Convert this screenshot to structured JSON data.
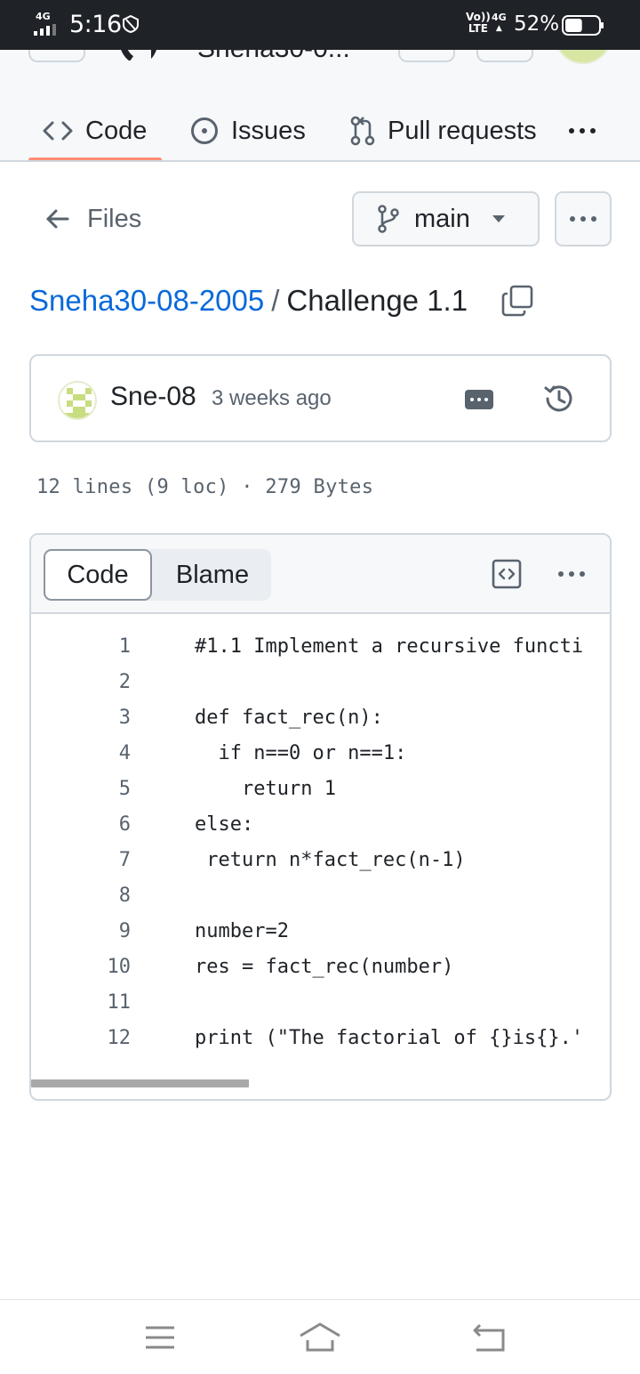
{
  "status_bar": {
    "network_label": "4G",
    "time": "5:16",
    "volte_top": "Vo))",
    "volte_bottom": "LTE",
    "data_4g": "4G",
    "battery_percent": "52%",
    "battery_level": 0.52
  },
  "repo_header": {
    "repo_name_partial": "Sneha30-0..."
  },
  "tabs": [
    {
      "label": "Code",
      "icon": "code-icon",
      "active": true
    },
    {
      "label": "Issues",
      "icon": "issue-opened-icon",
      "active": false
    },
    {
      "label": "Pull requests",
      "icon": "git-pull-request-icon",
      "active": false
    }
  ],
  "files_nav": {
    "back_label": "Files",
    "branch": "main"
  },
  "breadcrumb": {
    "owner": "Sneha30-08-2005",
    "separator": "/",
    "file": "Challenge 1.1"
  },
  "commit": {
    "author": "Sne-08",
    "time": "3 weeks ago"
  },
  "file_meta": "12 lines (9 loc) · 279 Bytes",
  "code_view": {
    "tab_code": "Code",
    "tab_blame": "Blame",
    "lines": [
      {
        "n": "1",
        "text": "#1.1 Implement a recursive functi"
      },
      {
        "n": "2",
        "text": ""
      },
      {
        "n": "3",
        "text": "def fact_rec(n):"
      },
      {
        "n": "4",
        "text": "  if n==0 or n==1:"
      },
      {
        "n": "5",
        "text": "    return 1"
      },
      {
        "n": "6",
        "text": "else:"
      },
      {
        "n": "7",
        "text": " return n*fact_rec(n-1)"
      },
      {
        "n": "8",
        "text": ""
      },
      {
        "n": "9",
        "text": "number=2"
      },
      {
        "n": "10",
        "text": "res = fact_rec(number)"
      },
      {
        "n": "11",
        "text": ""
      },
      {
        "n": "12",
        "text": "print (\"The factorial of {}is{}.'"
      }
    ]
  },
  "colors": {
    "link": "#0969da",
    "active_tab_underline": "#fd8c73",
    "muted_text": "#59636e",
    "border": "#d0d7de"
  }
}
